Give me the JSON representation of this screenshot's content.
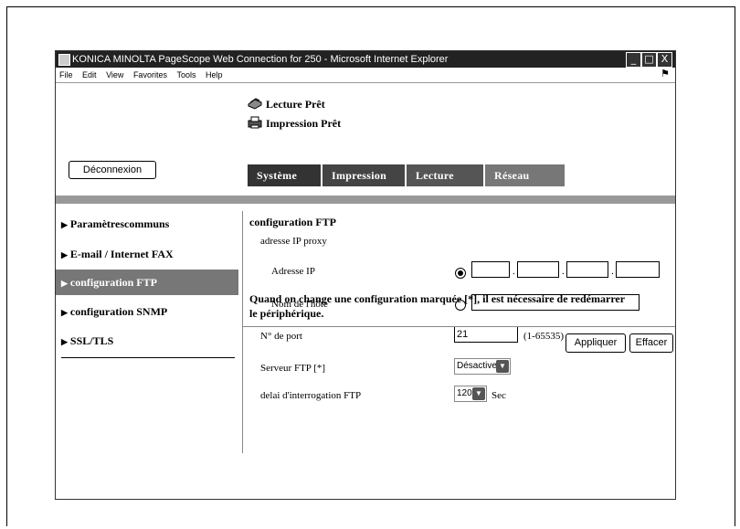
{
  "window": {
    "title": "KONICA MINOLTA PageScope Web Connection for 250 - Microsoft Internet Explorer",
    "controls": [
      "_",
      "□",
      "X"
    ]
  },
  "menubar": {
    "items": [
      "File",
      "Edit",
      "View",
      "Favorites",
      "Tools",
      "Help"
    ]
  },
  "status": {
    "scan": "Lecture Prêt",
    "print": "Impression Prêt"
  },
  "logout_label": "Déconnexion",
  "tabs": [
    "Système",
    "Impression",
    "Lecture",
    "Réseau"
  ],
  "sidebar": {
    "items": [
      {
        "label": "Paramètrescommuns",
        "active": false
      },
      {
        "label": "E-mail / Internet FAX",
        "active": false
      },
      {
        "label": "configuration FTP",
        "active": true
      },
      {
        "label": "configuration SNMP",
        "active": false
      },
      {
        "label": "SSL/TLS",
        "active": false
      }
    ]
  },
  "form": {
    "title": "configuration FTP",
    "proxy_label": "adresse IP proxy",
    "ip_label": "Adresse IP",
    "ip_octets": [
      "",
      "",
      "",
      ""
    ],
    "host_label": "Nom de l'hôte",
    "host_value": "",
    "port_label": "N° de port",
    "port_value": "21",
    "port_range": "(1-65535)",
    "server_label": "Serveur FTP [*]",
    "server_value": "Désactiver",
    "delay_label": "delai d'interrogation FTP",
    "delay_value": "120",
    "delay_unit": "Sec",
    "note": "Quand on change une configuration marquée [*], il est nécessaire de redémarrer le périphérique."
  },
  "buttons": {
    "apply": "Appliquer",
    "clear": "Effacer"
  }
}
